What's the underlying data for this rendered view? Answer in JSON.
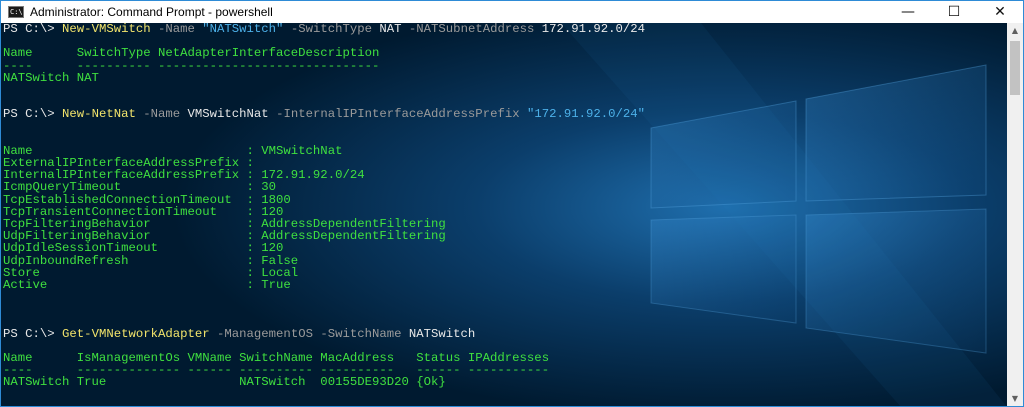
{
  "window": {
    "title": "Administrator: Command Prompt - powershell",
    "app_icon_text": "C:\\",
    "buttons": {
      "minimize": "—",
      "maximize": "☐",
      "close": "✕"
    }
  },
  "console": {
    "colors": {
      "background": "#001b33",
      "prompt": "#e8e8e8",
      "command": "#f2e46b",
      "parameter": "#9a9a9a",
      "string": "#4cb0e8",
      "output": "#3fe03f"
    },
    "lines": [
      [
        {
          "t": "PS C:\\> ",
          "c": "prompt"
        },
        {
          "t": "New-VMSwitch",
          "c": "cmd"
        },
        {
          "t": " -Name ",
          "c": "param"
        },
        {
          "t": "\"NATSwitch\"",
          "c": "str"
        },
        {
          "t": " -SwitchType ",
          "c": "param"
        },
        {
          "t": "NAT",
          "c": "arg"
        },
        {
          "t": " -NATSubnetAddress ",
          "c": "param"
        },
        {
          "t": "172.91.92.0/24",
          "c": "arg"
        }
      ],
      [],
      [
        {
          "t": "Name      SwitchType NetAdapterInterfaceDescription",
          "c": "out"
        }
      ],
      [
        {
          "t": "----      ---------- ------------------------------",
          "c": "out"
        }
      ],
      [
        {
          "t": "NATSwitch NAT",
          "c": "out"
        }
      ],
      [],
      [],
      [
        {
          "t": "PS C:\\> ",
          "c": "prompt"
        },
        {
          "t": "New-NetNat",
          "c": "cmd"
        },
        {
          "t": " -Name ",
          "c": "param"
        },
        {
          "t": "VMSwitchNat",
          "c": "arg"
        },
        {
          "t": " -InternalIPInterfaceAddressPrefix ",
          "c": "param"
        },
        {
          "t": "\"172.91.92.0/24\"",
          "c": "str"
        }
      ],
      [],
      [],
      [
        {
          "t": "Name                             : VMSwitchNat",
          "c": "out"
        }
      ],
      [
        {
          "t": "ExternalIPInterfaceAddressPrefix :",
          "c": "out"
        }
      ],
      [
        {
          "t": "InternalIPInterfaceAddressPrefix : 172.91.92.0/24",
          "c": "out"
        }
      ],
      [
        {
          "t": "IcmpQueryTimeout                 : 30",
          "c": "out"
        }
      ],
      [
        {
          "t": "TcpEstablishedConnectionTimeout  : 1800",
          "c": "out"
        }
      ],
      [
        {
          "t": "TcpTransientConnectionTimeout    : 120",
          "c": "out"
        }
      ],
      [
        {
          "t": "TcpFilteringBehavior             : AddressDependentFiltering",
          "c": "out"
        }
      ],
      [
        {
          "t": "UdpFilteringBehavior             : AddressDependentFiltering",
          "c": "out"
        }
      ],
      [
        {
          "t": "UdpIdleSessionTimeout            : 120",
          "c": "out"
        }
      ],
      [
        {
          "t": "UdpInboundRefresh                : False",
          "c": "out"
        }
      ],
      [
        {
          "t": "Store                            : Local",
          "c": "out"
        }
      ],
      [
        {
          "t": "Active                           : True",
          "c": "out"
        }
      ],
      [],
      [],
      [],
      [
        {
          "t": "PS C:\\> ",
          "c": "prompt"
        },
        {
          "t": "Get-VMNetworkAdapter",
          "c": "cmd"
        },
        {
          "t": " -ManagementOS -SwitchName ",
          "c": "param"
        },
        {
          "t": "NATSwitch",
          "c": "arg"
        }
      ],
      [],
      [
        {
          "t": "Name      IsManagementOs VMName SwitchName MacAddress   Status IPAddresses",
          "c": "out"
        }
      ],
      [
        {
          "t": "----      -------------- ------ ---------- ----------   ------ -----------",
          "c": "out"
        }
      ],
      [
        {
          "t": "NATSwitch True                  NATSwitch  00155DE93D20 {Ok}",
          "c": "out"
        }
      ]
    ]
  }
}
